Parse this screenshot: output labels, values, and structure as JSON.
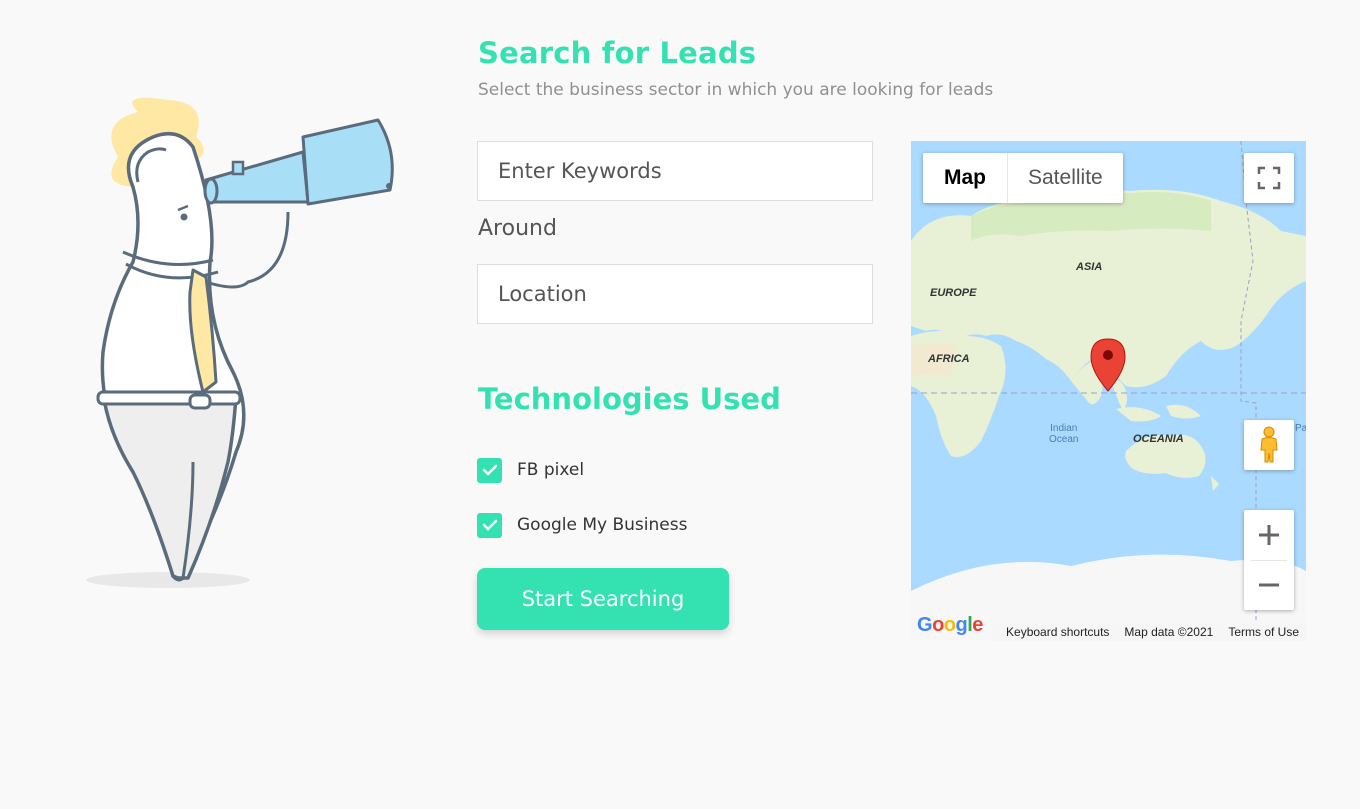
{
  "header": {
    "title": "Search for Leads",
    "subtitle": "Select the business sector in which you are looking for leads"
  },
  "form": {
    "keywords_placeholder": "Enter Keywords",
    "around_label": "Around",
    "location_placeholder": "Location"
  },
  "technologies": {
    "title": "Technologies Used",
    "items": [
      {
        "label": "FB pixel",
        "checked": true
      },
      {
        "label": "Google My Business",
        "checked": true
      }
    ]
  },
  "actions": {
    "start_label": "Start Searching"
  },
  "map": {
    "type_tabs": [
      "Map",
      "Satellite"
    ],
    "selected_tab": "Map",
    "labels": {
      "asia": "ASIA",
      "europe": "EUROPE",
      "africa": "AFRICA",
      "oceania": "OCEANIA",
      "indian_ocean_1": "Indian",
      "indian_ocean_2": "Ocean",
      "pacific_fragment": "Pac"
    },
    "footer": {
      "logo": "Google",
      "shortcuts": "Keyboard shortcuts",
      "map_data": "Map data ©2021",
      "terms": "Terms of Use"
    }
  },
  "colors": {
    "accent": "#33e1b1",
    "ocean": "#aadaff",
    "land": "#e8f0d6",
    "marker": "#ea4335"
  }
}
